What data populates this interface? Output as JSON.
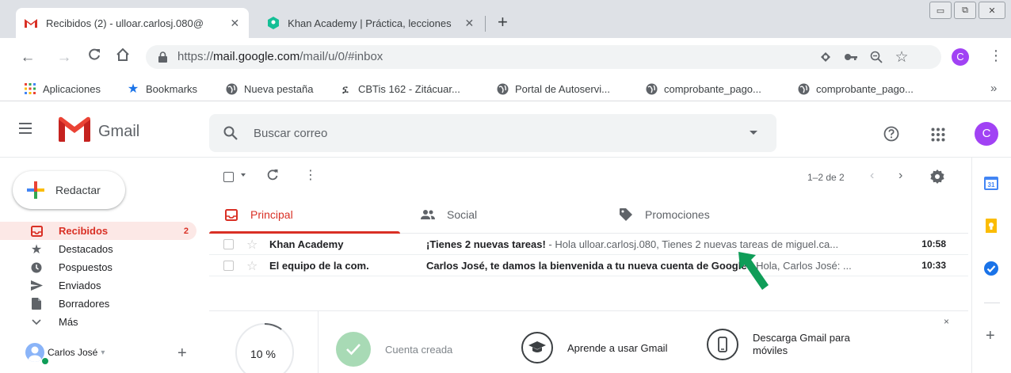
{
  "browser": {
    "tabs": [
      {
        "title": "Recibidos (2) - ulloar.carlosj.080@",
        "active": true
      },
      {
        "title": "Khan Academy | Práctica, lecciones",
        "active": false
      }
    ],
    "new_tab": "+",
    "close": "✕",
    "window": {
      "minimize": "▭",
      "restore": "⧉",
      "close": "✕"
    },
    "url": {
      "scheme": "https://",
      "host": "mail.google.com",
      "path": "/mail/u/0/#inbox"
    },
    "profile_initial": "C",
    "bookmarks": [
      {
        "label": "Aplicaciones",
        "icon": "apps-grid-icon"
      },
      {
        "label": "Bookmarks",
        "icon": "star-icon"
      },
      {
        "label": "Nueva pestaña",
        "icon": "globe-icon"
      },
      {
        "label": "CBTis 162 - Zitácuar...",
        "icon": "dgeti-icon"
      },
      {
        "label": "Portal de Autoservi...",
        "icon": "globe-icon"
      },
      {
        "label": "comprobante_pago...",
        "icon": "globe-icon"
      },
      {
        "label": "comprobante_pago...",
        "icon": "globe-icon"
      }
    ],
    "bookmarks_more": "»"
  },
  "gmail": {
    "app_name": "Gmail",
    "search_placeholder": "Buscar correo",
    "avatar_initial": "C",
    "compose_label": "Redactar",
    "nav": [
      {
        "label": "Recibidos",
        "count": "2",
        "icon": "inbox-icon",
        "active": true
      },
      {
        "label": "Destacados",
        "count": "",
        "icon": "star-icon",
        "active": false
      },
      {
        "label": "Pospuestos",
        "count": "",
        "icon": "clock-icon",
        "active": false
      },
      {
        "label": "Enviados",
        "count": "",
        "icon": "send-icon",
        "active": false
      },
      {
        "label": "Borradores",
        "count": "",
        "icon": "draft-icon",
        "active": false
      },
      {
        "label": "Más",
        "count": "",
        "icon": "chevron-down-icon",
        "active": false
      }
    ],
    "account_name": "Carlos José",
    "pager": "1–2 de 2",
    "category_tabs": [
      {
        "label": "Principal",
        "icon": "inbox-icon",
        "active": true
      },
      {
        "label": "Social",
        "icon": "people-icon",
        "active": false
      },
      {
        "label": "Promociones",
        "icon": "tag-icon",
        "active": false
      }
    ],
    "emails": [
      {
        "sender": "Khan Academy",
        "subject": "¡Tienes 2 nuevas tareas!",
        "snippet": " - Hola ulloar.carlosj.080, Tienes 2 nuevas tareas de miguel.ca...",
        "time": "10:58"
      },
      {
        "sender": "El equipo de la com.",
        "subject": "Carlos José, te damos la bienvenida a tu nueva cuenta de Google",
        "snippet": " - Hola, Carlos José: ...",
        "time": "10:33"
      }
    ],
    "setup": {
      "progress": 10,
      "progress_label": "10 %",
      "steps": [
        {
          "label": "Cuenta creada",
          "done": true
        },
        {
          "label": "Aprende a usar Gmail",
          "done": false
        },
        {
          "label": "Descarga Gmail para móviles",
          "done": false
        }
      ],
      "close": "×"
    }
  },
  "colors": {
    "accent": "#d93025",
    "avatar": "#a142f4",
    "arrow": "#0f9d58"
  }
}
